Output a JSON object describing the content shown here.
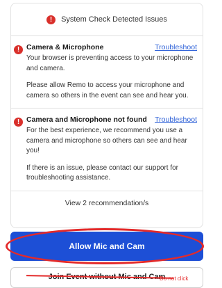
{
  "header": {
    "title": "System Check Detected Issues"
  },
  "issues": [
    {
      "title": "Camera & Microphone",
      "link": "Troubleshoot",
      "paragraphs": [
        "Your browser is preventing access to your microphone and camera.",
        "Please allow Remo to access your microphone and camera so others in the event can see and hear you."
      ]
    },
    {
      "title": "Camera and Microphone not found",
      "link": "Troubleshoot",
      "paragraphs": [
        "For the best experience, we recommend you use a camera and microphone so others can see and hear you!",
        "If there is an issue, please contact our support for troubleshooting assistance."
      ]
    }
  ],
  "recommendations": {
    "label": "View 2 recommendation/s"
  },
  "buttons": {
    "allow": "Allow Mic and Cam",
    "join_without": "Join Event without Mic and Cam"
  },
  "annotation": {
    "note": "Do not click"
  },
  "colors": {
    "error": "#d9302b",
    "link": "#2f62d8",
    "primary": "#1d4fd6",
    "annotation": "#e32a2a"
  },
  "icons": {
    "error": "exclamation-circle-icon"
  }
}
